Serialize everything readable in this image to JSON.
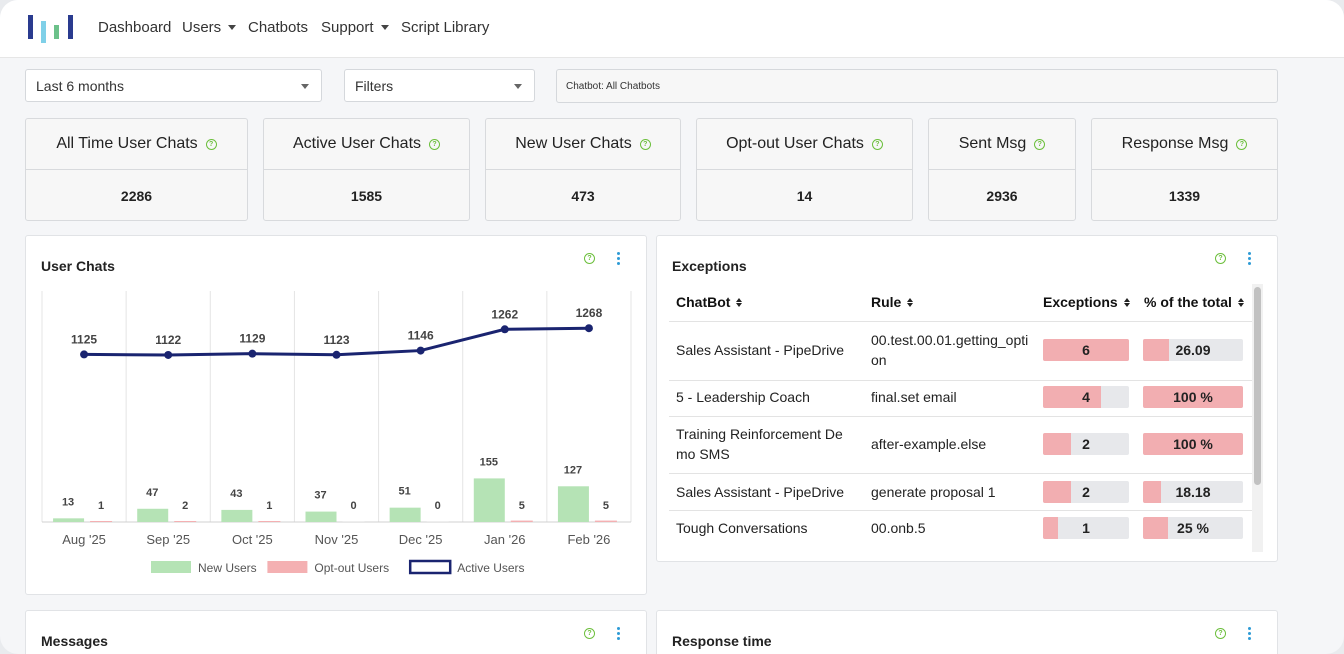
{
  "nav": {
    "items": [
      {
        "label": "Dashboard",
        "dropdown": false
      },
      {
        "label": "Users",
        "dropdown": true
      },
      {
        "label": "Chatbots",
        "dropdown": false
      },
      {
        "label": "Support",
        "dropdown": true
      },
      {
        "label": "Script Library",
        "dropdown": false
      }
    ]
  },
  "filters": {
    "period": "Last 6 months",
    "filters_label": "Filters",
    "chatbot": "Chatbot: All Chatbots"
  },
  "kpis": [
    {
      "label": "All Time User Chats",
      "value": "2286"
    },
    {
      "label": "Active User Chats",
      "value": "1585"
    },
    {
      "label": "New User Chats",
      "value": "473"
    },
    {
      "label": "Opt-out User Chats",
      "value": "14"
    },
    {
      "label": "Sent Msg",
      "value": "2936"
    },
    {
      "label": "Response Msg",
      "value": "1339"
    }
  ],
  "user_chats": {
    "title": "User Chats"
  },
  "chart_data": {
    "type": "bar",
    "categories": [
      "Aug '25",
      "Sep '25",
      "Oct '25",
      "Nov '25",
      "Dec '25",
      "Jan '26",
      "Feb '26"
    ],
    "series": [
      {
        "name": "New Users",
        "type": "bar",
        "values": [
          13,
          47,
          43,
          37,
          51,
          155,
          127
        ],
        "color": "#b5e3b5"
      },
      {
        "name": "Opt-out Users",
        "type": "bar",
        "values": [
          1,
          2,
          1,
          0,
          0,
          5,
          5
        ],
        "color": "#f4b0b2"
      },
      {
        "name": "Active Users",
        "type": "line",
        "values": [
          1125,
          1122,
          1129,
          1123,
          1146,
          1262,
          1268
        ],
        "color": "#1a2470"
      }
    ],
    "grid": true,
    "legend": "bottom"
  },
  "exceptions": {
    "title": "Exceptions",
    "headers": [
      "ChatBot",
      "Rule",
      "Exceptions",
      "% of the total"
    ],
    "rows": [
      {
        "chatbot": "Sales Assistant - PipeDrive",
        "rule": "00.test.00.01.getting_option",
        "exceptions": "6",
        "exceptions_level": 1.0,
        "percent": "26.09",
        "percent_level": 0.26
      },
      {
        "chatbot": "5 - Leadership Coach",
        "rule": "final.set email",
        "exceptions": "4",
        "exceptions_level": 0.67,
        "percent": "100 %",
        "percent_level": 1.0
      },
      {
        "chatbot": "Training Reinforcement Demo SMS",
        "rule": "after-example.else",
        "exceptions": "2",
        "exceptions_level": 0.33,
        "percent": "100 %",
        "percent_level": 1.0
      },
      {
        "chatbot": "Sales Assistant - PipeDrive",
        "rule": "generate proposal 1",
        "exceptions": "2",
        "exceptions_level": 0.33,
        "percent": "18.18",
        "percent_level": 0.18
      },
      {
        "chatbot": "Tough Conversations",
        "rule": "00.onb.5",
        "exceptions": "1",
        "exceptions_level": 0.17,
        "percent": "25 %",
        "percent_level": 0.25
      }
    ]
  },
  "messages": {
    "title": "Messages"
  },
  "response_time": {
    "title": "Response time"
  },
  "colors": {
    "accent": "#2e9bd6",
    "help": "#6cbf3c",
    "bar": "#f2aeb1",
    "line": "#1a2470"
  }
}
